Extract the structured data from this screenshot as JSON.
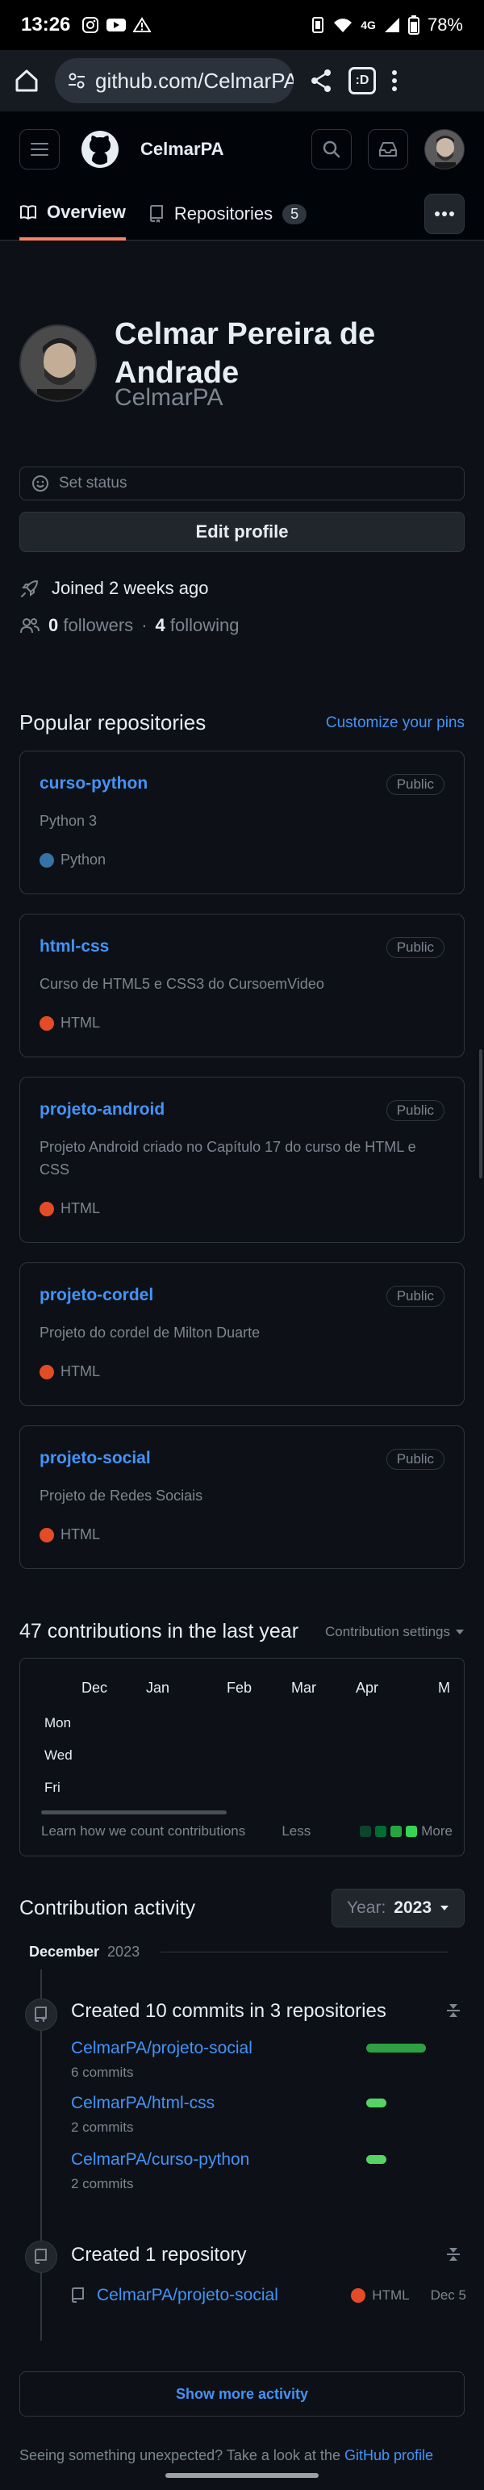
{
  "status_bar": {
    "time": "13:26",
    "battery": "78%",
    "network": "4G"
  },
  "browser": {
    "url": "github.com/CelmarPA",
    "tab_count": ":D"
  },
  "header": {
    "username": "CelmarPA",
    "tabs": [
      {
        "label": "Overview"
      },
      {
        "label": "Repositories",
        "count": "5"
      }
    ]
  },
  "profile": {
    "name": "Celmar Pereira de Andrade",
    "login": "CelmarPA",
    "set_status": "Set status",
    "edit_profile": "Edit profile",
    "joined": "Joined 2 weeks ago",
    "followers_count": "0",
    "followers_label": "followers",
    "separator": "·",
    "following_count": "4",
    "following_label": "following"
  },
  "popular": {
    "title": "Popular repositories",
    "customize": "Customize your pins",
    "repos": [
      {
        "name": "curso-python",
        "visibility": "Public",
        "description": "Python 3",
        "language": "Python",
        "color": "#3572A5"
      },
      {
        "name": "html-css",
        "visibility": "Public",
        "description": "Curso de HTML5 e CSS3 do CursoemVideo",
        "language": "HTML",
        "color": "#e34c26"
      },
      {
        "name": "projeto-android",
        "visibility": "Public",
        "description": "Projeto Android criado no Capítulo 17 do curso de HTML e CSS",
        "language": "HTML",
        "color": "#e34c26"
      },
      {
        "name": "projeto-cordel",
        "visibility": "Public",
        "description": "Projeto do cordel de Milton Duarte",
        "language": "HTML",
        "color": "#e34c26"
      },
      {
        "name": "projeto-social",
        "visibility": "Public",
        "description": "Projeto de Redes Sociais",
        "language": "HTML",
        "color": "#e34c26"
      }
    ]
  },
  "contributions": {
    "title": "47 contributions in the last year",
    "settings": "Contribution settings",
    "months": [
      "Dec",
      "Jan",
      "Feb",
      "Mar",
      "Apr",
      "M"
    ],
    "days": [
      "Mon",
      "Wed",
      "Fri"
    ],
    "learn": "Learn how we count contributions",
    "less": "Less",
    "more": "More",
    "legend_colors": [
      "#0e4429",
      "#006d32",
      "#26a641",
      "#39d353"
    ]
  },
  "activity": {
    "title": "Contribution activity",
    "year_label": "Year:",
    "year": "2023",
    "month": "December",
    "month_year": "2023",
    "commits_title": "Created 10 commits in 3 repositories",
    "commit_repos": [
      {
        "name": "CelmarPA/projeto-social",
        "commits": "6 commits",
        "share": 0.6
      },
      {
        "name": "CelmarPA/html-css",
        "commits": "2 commits",
        "share": 0.2
      },
      {
        "name": "CelmarPA/curso-python",
        "commits": "2 commits",
        "share": 0.2
      }
    ],
    "created_title": "Created 1 repository",
    "created_repo": {
      "name": "CelmarPA/projeto-social",
      "language": "HTML",
      "color": "#e34c26",
      "date": "Dec 5"
    },
    "show_more": "Show more activity",
    "footnote_text": "Seeing something unexpected? Take a look at the",
    "footnote_link": "GitHub profile"
  },
  "colors": {
    "background": "#0d1117",
    "link": "#4493f8",
    "muted": "#7d8590",
    "border": "#30363d",
    "active_tab": "#f78166"
  }
}
